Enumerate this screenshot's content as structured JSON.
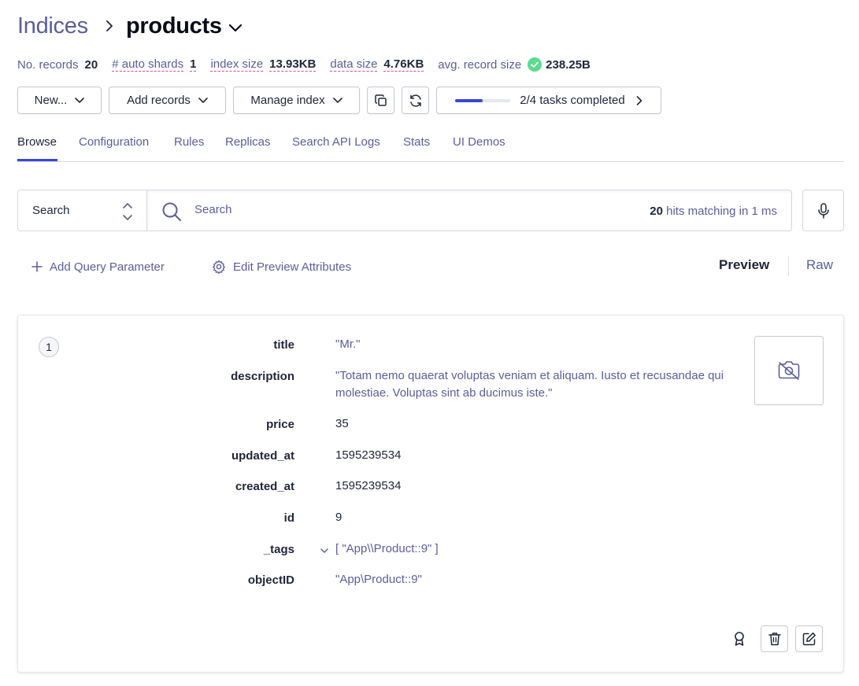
{
  "breadcrumb": {
    "root": "Indices",
    "current": "products"
  },
  "stats": [
    {
      "label": "No. records",
      "value": "20",
      "dashed": false
    },
    {
      "label": "# auto shards",
      "value": "1",
      "dashed": true
    },
    {
      "label": "index size",
      "value": "13.93KB",
      "dashed": true
    },
    {
      "label": "data size",
      "value": "4.76KB",
      "dashed": true
    },
    {
      "label": "avg. record size",
      "value": "238.25B",
      "dashed": false
    }
  ],
  "toolbar": {
    "new_label": "New...",
    "add_records_label": "Add records",
    "manage_index_label": "Manage index",
    "tasks_label": "2/4 tasks completed",
    "tasks_progress": 0.5
  },
  "tabs": [
    "Browse",
    "Configuration",
    "Rules",
    "Replicas",
    "Search API Logs",
    "Stats",
    "UI Demos"
  ],
  "active_tab": "Browse",
  "search": {
    "mode": "Search",
    "placeholder": "Search",
    "hits_count": "20",
    "hits_text": " hits matching in 1 ms"
  },
  "actions": {
    "add_query_param": "Add Query Parameter",
    "edit_preview": "Edit Preview Attributes",
    "preview": "Preview",
    "raw": "Raw"
  },
  "record": {
    "rank": "1",
    "attributes": [
      {
        "key": "title",
        "value": "\"Mr.\"",
        "type": "string"
      },
      {
        "key": "description",
        "value": "\"Totam nemo quaerat voluptas veniam et aliquam. Iusto et recusandae qui molestiae. Voluptas sint ab ducimus iste.\"",
        "type": "string"
      },
      {
        "key": "price",
        "value": "35",
        "type": "number"
      },
      {
        "key": "updated_at",
        "value": "1595239534",
        "type": "number"
      },
      {
        "key": "created_at",
        "value": "1595239534",
        "type": "number"
      },
      {
        "key": "id",
        "value": "9",
        "type": "number"
      },
      {
        "key": "_tags",
        "value": "[ \"App\\\\Product::9\" ]",
        "type": "string"
      },
      {
        "key": "objectID",
        "value": "\"App\\Product::9\"",
        "type": "string"
      }
    ]
  },
  "colors": {
    "accent": "#3a46d8",
    "muted": "#5a5e9a",
    "success": "#5adb8f",
    "dashed_underline": "#e8487d"
  }
}
